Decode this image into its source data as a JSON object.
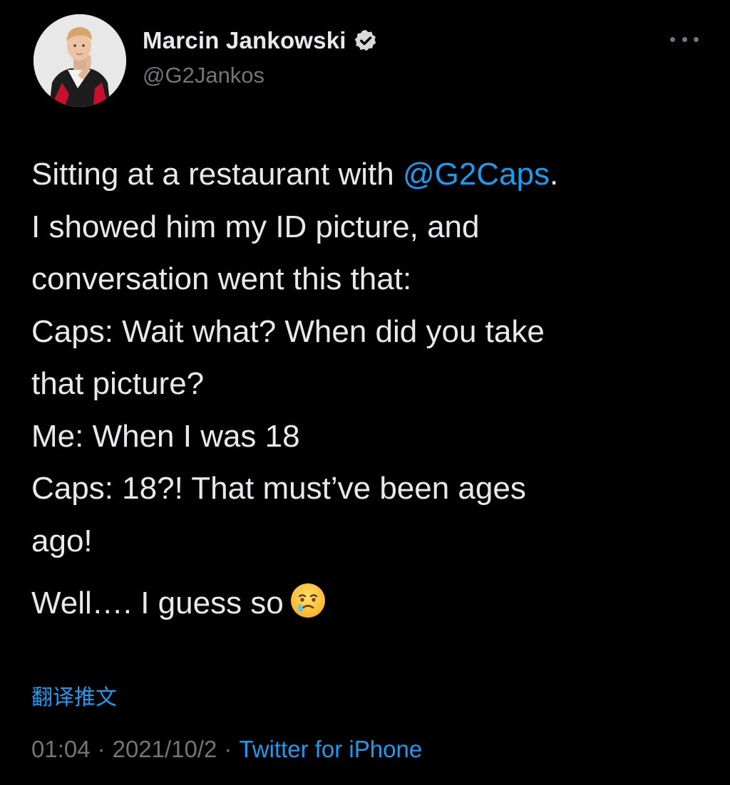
{
  "author": {
    "display_name": "Marcin Jankowski",
    "handle": "@G2Jankos",
    "verified_icon": "verified-badge-icon",
    "avatar_icon": "profile-photo"
  },
  "more_icon": "ellipsis-icon",
  "tweet": {
    "line1_prefix": "Sitting at a restaurant with ",
    "mention": "@G2Caps",
    "line1_suffix": ".",
    "line2": "I showed him my ID picture, and",
    "line3": "conversation went this that:",
    "line4": "Caps: Wait what? When did you take",
    "line5": "that picture?",
    "line6": "Me: When I was 18",
    "line7": "Caps: 18?! That must’ve been ages",
    "line8": "ago!",
    "line9": "Well…. I guess so",
    "emoji_icon": "face-holding-back-tears-emoji"
  },
  "translate_label": "翻译推文",
  "meta": {
    "time": "01:04",
    "date": "2021/10/2",
    "separator": "·",
    "source": "Twitter for iPhone"
  },
  "colors": {
    "background": "#000000",
    "text": "#e7e9ea",
    "secondary": "#71767b",
    "accent": "#1d9bf0"
  }
}
